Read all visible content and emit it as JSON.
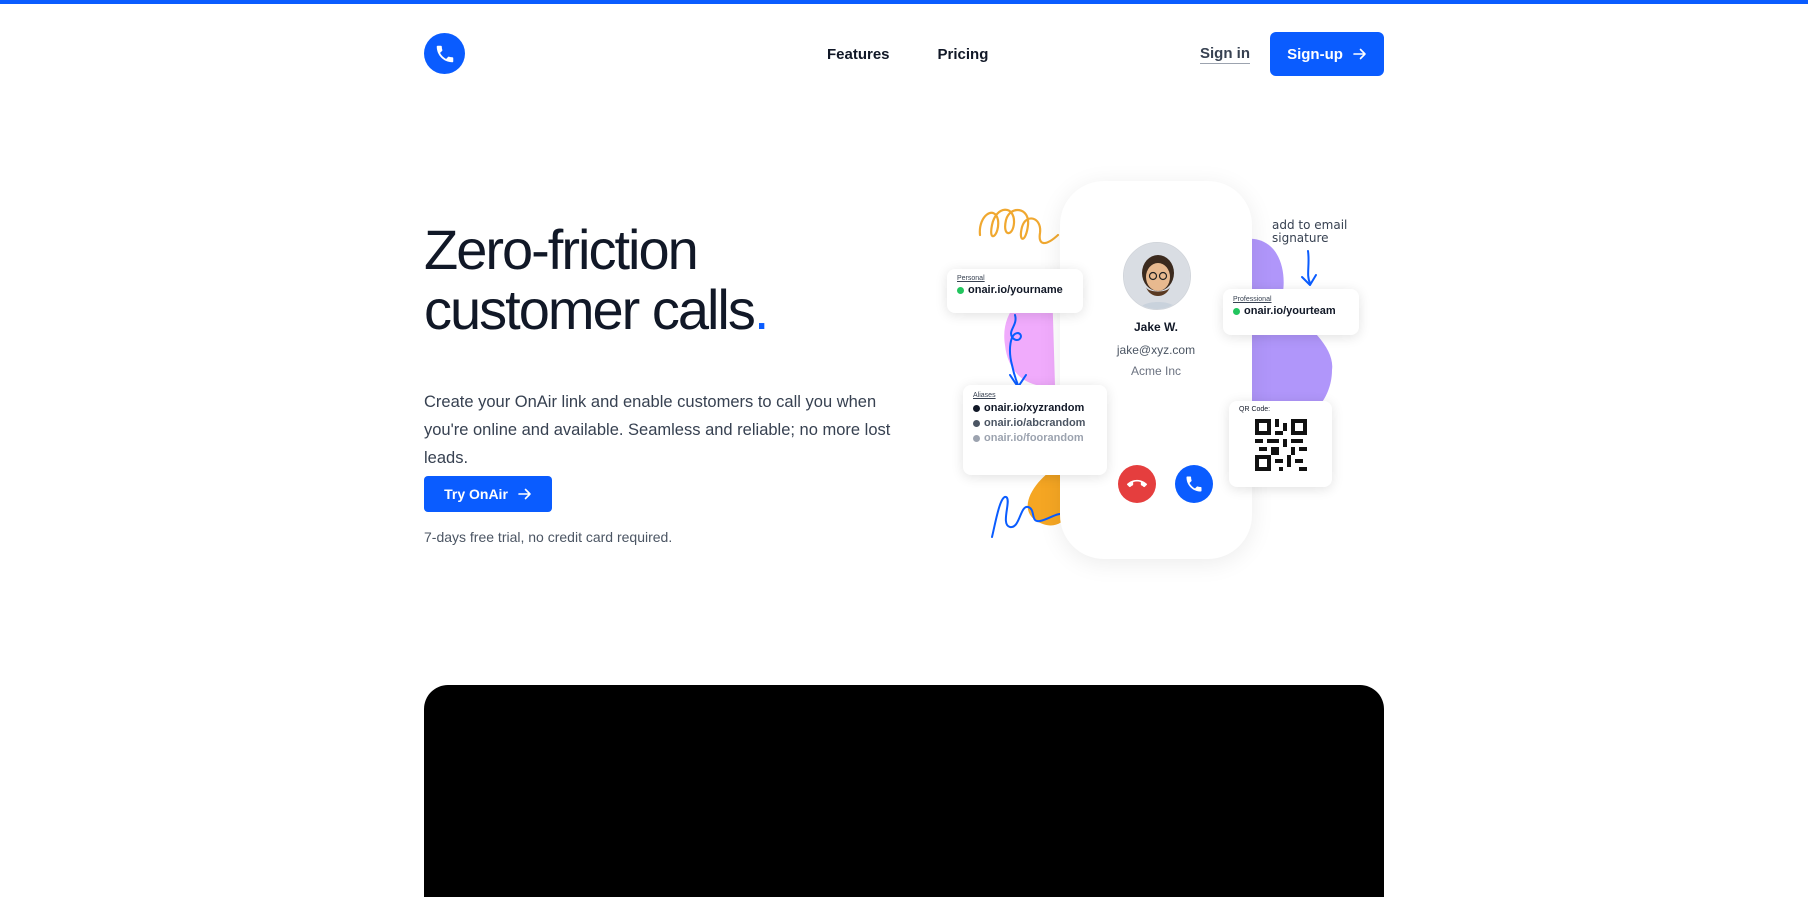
{
  "colors": {
    "accent": "#0a5cff",
    "decline": "#e53e3e",
    "online": "#22c55e"
  },
  "header": {
    "logo_icon": "phone-icon",
    "nav": [
      {
        "label": "Features"
      },
      {
        "label": "Pricing"
      }
    ],
    "signin_label": "Sign in",
    "signup_label": "Sign-up"
  },
  "hero": {
    "title_line1": "Zero-friction",
    "title_line2": "customer calls",
    "title_dot": ".",
    "description": "Create your OnAir link and enable customers to call you when you're online and available. Seamless and reliable; no more lost leads.",
    "cta_label": "Try OnAir",
    "note": "7-days free trial, no credit card required."
  },
  "illustration": {
    "contact": {
      "name": "Jake W.",
      "email": "jake@xyz.com",
      "company": "Acme Inc"
    },
    "personal": {
      "label": "Personal",
      "link": "onair.io/yourname"
    },
    "professional": {
      "label": "Professional",
      "link": "onair.io/yourteam"
    },
    "aliases": {
      "label": "Aliases",
      "items": [
        "onair.io/xyzrandom",
        "onair.io/abcrandom",
        "onair.io/foorandom"
      ]
    },
    "qr": {
      "label": "QR Code:"
    },
    "annotation": "add to email signature"
  }
}
